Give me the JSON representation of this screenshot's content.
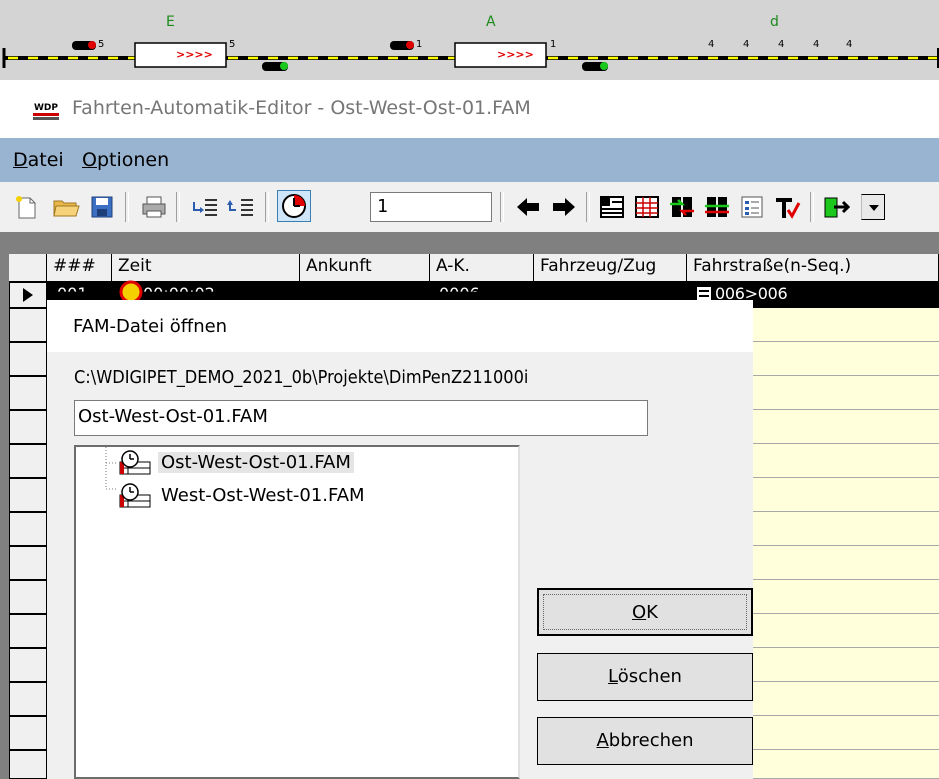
{
  "track": {
    "labels": {
      "e": "E",
      "a": "A",
      "d": "d"
    },
    "block_arrows": [
      ">>>>",
      ">>>>"
    ],
    "numbers": [
      "5",
      "5",
      "1",
      "1",
      "4",
      "4",
      "4",
      "4",
      "4"
    ]
  },
  "window": {
    "title": "Fahrten-Automatik-Editor - Ost-West-Ost-01.FAM"
  },
  "menu": {
    "datei": {
      "mnemonic": "D",
      "rest": "atei"
    },
    "optionen": {
      "mnemonic": "O",
      "rest": "ptionen"
    }
  },
  "toolbar": {
    "number_value": "1"
  },
  "grid": {
    "headers": [
      "###",
      "Zeit",
      "Ankunft",
      "A-K.",
      "Fahrzeug/Zug",
      "Fahrstraße(n-Seq.)"
    ],
    "row1": {
      "nr": "001",
      "zeit": "00:00:02",
      "ak": "0006",
      "fahrstrasse": "006>006"
    }
  },
  "dialog": {
    "title": "FAM-Datei öffnen",
    "path": "C:\\WDIGIPET_DEMO_2021_0b\\Projekte\\DimPenZ211000i",
    "filename": "Ost-West-Ost-01.FAM",
    "files": [
      "Ost-West-Ost-01.FAM",
      "West-Ost-West-01.FAM"
    ],
    "ok": {
      "mnemonic": "O",
      "rest": "K"
    },
    "loeschen": {
      "mnemonic": "L",
      "rest": "öschen"
    },
    "abbrechen": {
      "mnemonic": "A",
      "rest": "bbrechen"
    }
  },
  "colors": {
    "track_bg": "#d4d4d4",
    "menu_bg": "#99b4d1",
    "grid_yellow": "#ffffdc",
    "selection": "#000000",
    "signal_red": "#e00000",
    "signal_green": "#1cc81c"
  },
  "icons": [
    "new-file-icon",
    "open-folder-icon",
    "save-icon",
    "print-icon",
    "insert-row-icon",
    "delete-row-icon",
    "clock-icon",
    "arrow-left-icon",
    "arrow-right-icon",
    "route-table-icon",
    "grid-icon",
    "swap-icon",
    "tracks-icon",
    "list-icon",
    "t-check-icon",
    "exit-icon"
  ]
}
